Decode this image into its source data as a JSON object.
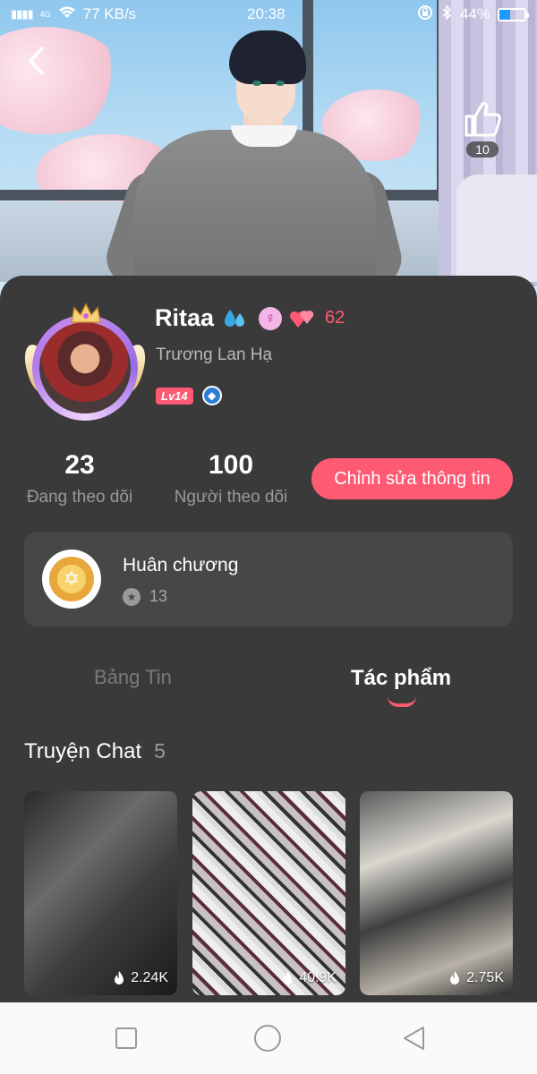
{
  "status_bar": {
    "signal": "4G",
    "network_speed": "77 KB/s",
    "time": "20:38",
    "battery_percent": "44%",
    "battery_level": 0.44
  },
  "header": {
    "back_icon": "chevron-left-icon",
    "like_icon": "thumbs-up-icon",
    "like_count": "10"
  },
  "profile": {
    "username": "Ritaa",
    "heart_count": "62",
    "real_name": "Trương Lan Hạ",
    "level": "Lv14",
    "gender_icon": "female-icon",
    "username_emoji_icon": "water-drops-icon"
  },
  "stats": {
    "following_count": "23",
    "following_label": "Đang theo dõi",
    "followers_count": "100",
    "followers_label": "Người theo dõi",
    "edit_button": "Chỉnh sửa thông tin"
  },
  "medal": {
    "title": "Huân chương",
    "count": "13"
  },
  "tabs": [
    {
      "label": "Bảng Tin",
      "active": false
    },
    {
      "label": "Tác phẩm",
      "active": true
    }
  ],
  "section": {
    "title": "Truyện Chat",
    "count": "5"
  },
  "stories": [
    {
      "views": "2.24K"
    },
    {
      "views": "40.9K"
    },
    {
      "views": "2.75K"
    }
  ],
  "colors": {
    "accent": "#ff5a74",
    "background": "#3a3a3a",
    "card": "#474747"
  }
}
